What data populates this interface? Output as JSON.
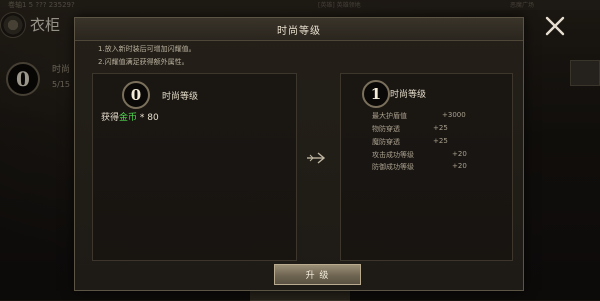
{
  "background": {
    "topbar_left": "卷轴1 5 ??? 23529?",
    "topbar_mid": "[英雄] 英雄领地",
    "topbar_right": "恶魔广场",
    "title": "衣柜",
    "level_value": "0",
    "side_label": "时尚",
    "side_value": "5/15"
  },
  "modal": {
    "title": "时尚等级",
    "desc": [
      "1.放入新时装后可增加闪耀值。",
      "2.闪耀值满足获得额外属性。"
    ],
    "current": {
      "level": "0",
      "label": "时尚等级",
      "reward_prefix": "获得",
      "reward_currency": "金币",
      "reward_suffix": " * 80"
    },
    "next": {
      "level": "1",
      "label": "时尚等级",
      "attributes": [
        {
          "name": "最大护盾值",
          "value": "+3000"
        },
        {
          "name": "物防穿透",
          "value": "+25"
        },
        {
          "name": "魔防穿透",
          "value": "+25"
        },
        {
          "name": "攻击成功等级",
          "value": "+20"
        },
        {
          "name": "防御成功等级",
          "value": "+20"
        }
      ]
    },
    "upgrade_label": "升 级"
  },
  "colors": {
    "currency": "#4fd84f",
    "accent": "#b8ab8f"
  },
  "icons": {
    "close": "close-icon",
    "arrow": "arrow-right-icon",
    "gear": "gear-icon"
  }
}
